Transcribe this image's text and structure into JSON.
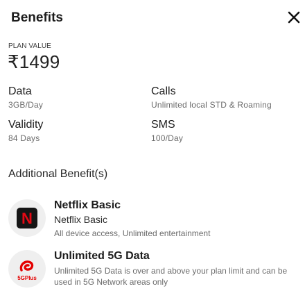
{
  "header": {
    "title": "Benefits"
  },
  "plan": {
    "label": "PLAN VALUE",
    "value": "₹1499"
  },
  "specs": {
    "data": {
      "label": "Data",
      "value": "3GB/Day"
    },
    "calls": {
      "label": "Calls",
      "value": "Unlimited local STD & Roaming"
    },
    "validity": {
      "label": "Validity",
      "value": "84 Days"
    },
    "sms": {
      "label": "SMS",
      "value": "100/Day"
    }
  },
  "additional": {
    "heading": "Additional Benefit(s)",
    "items": [
      {
        "title": "Netflix Basic",
        "subtitle": "Netflix Basic",
        "description": "All device access, Unlimited entertainment",
        "icon": "netflix-logo-icon",
        "icon_text": "N"
      },
      {
        "title": "Unlimited 5G Data",
        "description": "Unlimited 5G Data is over and above your plan limit and can be used in 5G Network areas only",
        "icon": "airtel-5gplus-icon",
        "icon_text": "5GPlus"
      }
    ]
  },
  "colors": {
    "netflix_red": "#e50914",
    "airtel_red": "#e40000"
  }
}
